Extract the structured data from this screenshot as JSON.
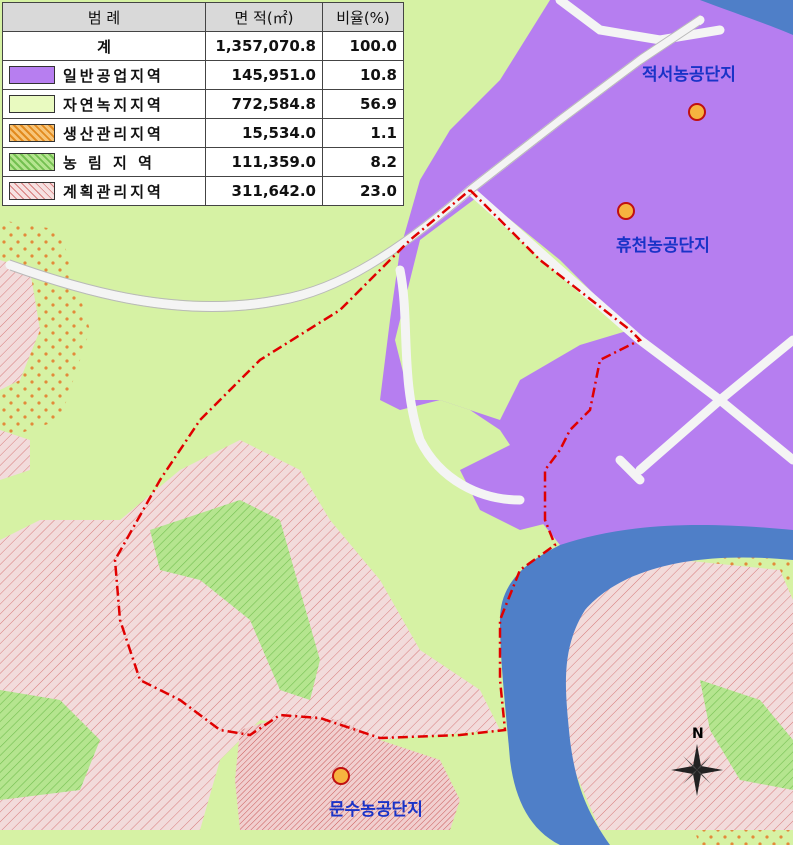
{
  "legend": {
    "headers": {
      "category": "범 례",
      "area": "면 적(㎡)",
      "ratio": "비율(%)"
    },
    "total": {
      "label": "계",
      "area": "1,357,070.8",
      "ratio": "100.0"
    },
    "rows": [
      {
        "label": "일반공업지역",
        "area": "145,951.0",
        "ratio": "10.8",
        "color": "#b77ef0"
      },
      {
        "label": "자연녹지지역",
        "area": "772,584.8",
        "ratio": "56.9",
        "color": "#e9fac0"
      },
      {
        "label": "생산관리지역",
        "area": "15,534.0",
        "ratio": "1.1",
        "color": "#f4a94a"
      },
      {
        "label": "농 림 지 역",
        "area": "111,359.0",
        "ratio": "8.2",
        "color": "#9fe07a"
      },
      {
        "label": "계획관리지역",
        "area": "311,642.0",
        "ratio": "23.0",
        "color": "#f3d7d7"
      }
    ]
  },
  "map": {
    "complexes": [
      {
        "name": "적서농공단지"
      },
      {
        "name": "휴천농공단지"
      },
      {
        "name": "문수농공단지"
      }
    ],
    "north_label": "N",
    "colors": {
      "natural_green": "#d6f2a4",
      "industrial": "#b67ef0",
      "planned_management": "#f2dbdb",
      "agri_forest": "#a6dd80",
      "river": "#4f7fc8",
      "boundary": "#e00000",
      "marker_fill": "#f6b33f",
      "marker_stroke": "#c01010"
    }
  }
}
